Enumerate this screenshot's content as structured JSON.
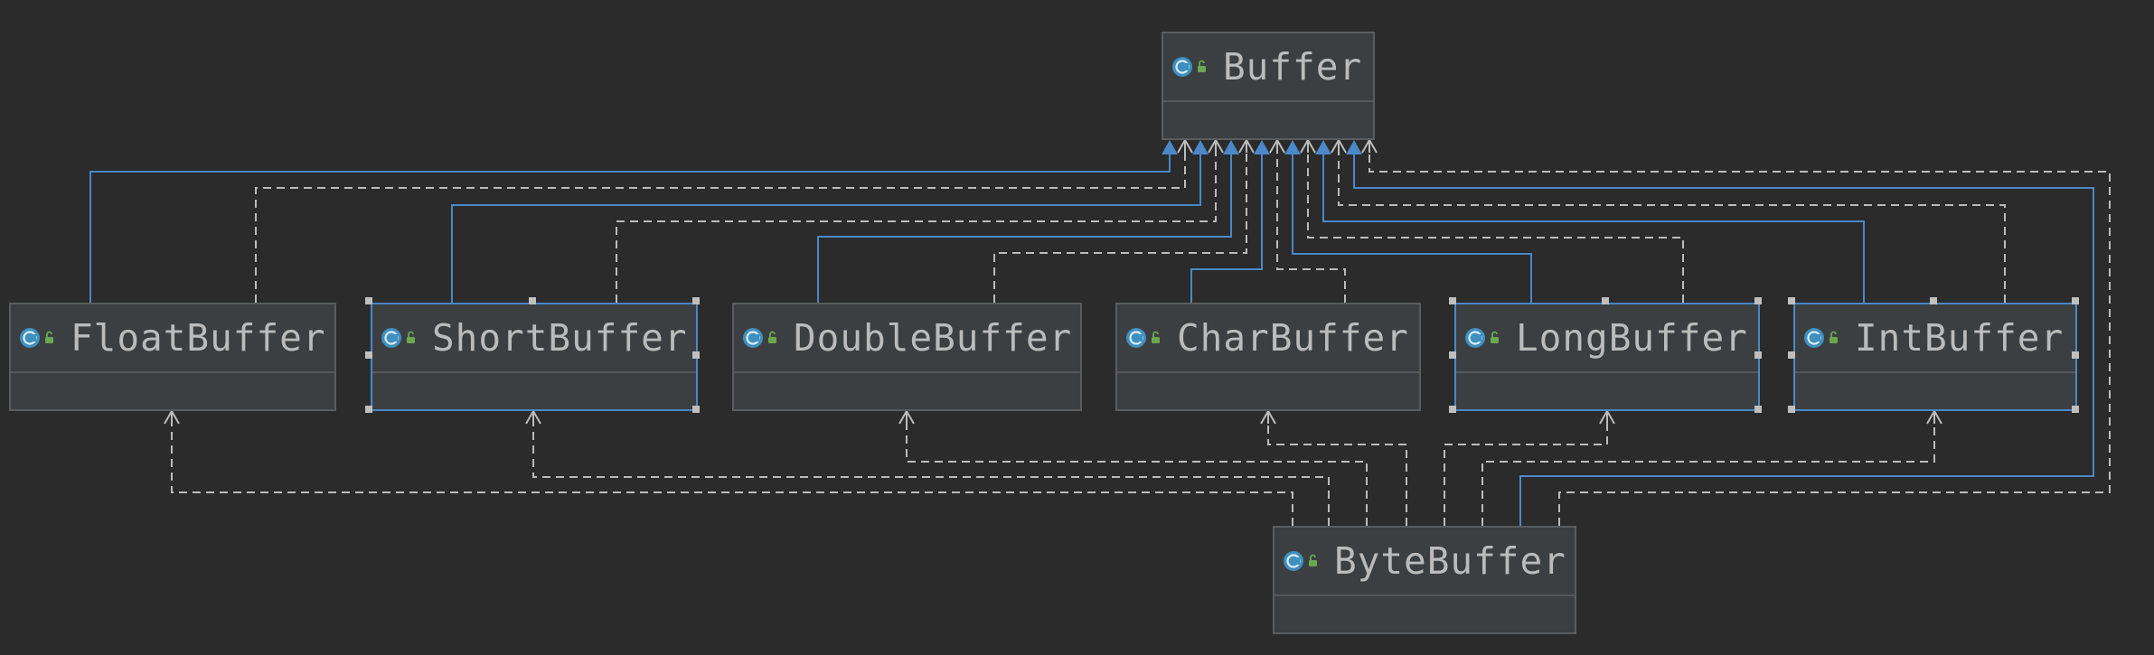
{
  "diagram": {
    "nodes": [
      {
        "id": "buffer",
        "label": "Buffer",
        "selected": false,
        "icon": "class-icon"
      },
      {
        "id": "float",
        "label": "FloatBuffer",
        "selected": false,
        "icon": "class-icon"
      },
      {
        "id": "short",
        "label": "ShortBuffer",
        "selected": true,
        "icon": "class-icon"
      },
      {
        "id": "double",
        "label": "DoubleBuffer",
        "selected": false,
        "icon": "class-icon"
      },
      {
        "id": "char",
        "label": "CharBuffer",
        "selected": false,
        "icon": "class-icon"
      },
      {
        "id": "long",
        "label": "LongBuffer",
        "selected": true,
        "icon": "class-icon"
      },
      {
        "id": "int",
        "label": "IntBuffer",
        "selected": true,
        "icon": "class-icon"
      },
      {
        "id": "byte",
        "label": "ByteBuffer",
        "selected": false,
        "icon": "class-icon"
      }
    ],
    "edges": [
      {
        "from": "float",
        "to": "buffer",
        "kind": "extends"
      },
      {
        "from": "float",
        "to": "buffer",
        "kind": "implements"
      },
      {
        "from": "short",
        "to": "buffer",
        "kind": "extends"
      },
      {
        "from": "short",
        "to": "buffer",
        "kind": "implements"
      },
      {
        "from": "double",
        "to": "buffer",
        "kind": "extends"
      },
      {
        "from": "double",
        "to": "buffer",
        "kind": "implements"
      },
      {
        "from": "char",
        "to": "buffer",
        "kind": "extends"
      },
      {
        "from": "char",
        "to": "buffer",
        "kind": "implements"
      },
      {
        "from": "long",
        "to": "buffer",
        "kind": "extends"
      },
      {
        "from": "long",
        "to": "buffer",
        "kind": "implements"
      },
      {
        "from": "int",
        "to": "buffer",
        "kind": "extends"
      },
      {
        "from": "int",
        "to": "buffer",
        "kind": "implements"
      },
      {
        "from": "byte",
        "to": "buffer",
        "kind": "extends"
      },
      {
        "from": "byte",
        "to": "buffer",
        "kind": "implements"
      },
      {
        "from": "byte",
        "to": "float",
        "kind": "implements"
      },
      {
        "from": "byte",
        "to": "short",
        "kind": "implements"
      },
      {
        "from": "byte",
        "to": "double",
        "kind": "implements"
      },
      {
        "from": "byte",
        "to": "char",
        "kind": "implements"
      },
      {
        "from": "byte",
        "to": "long",
        "kind": "implements"
      },
      {
        "from": "byte",
        "to": "int",
        "kind": "implements"
      }
    ],
    "colors": {
      "background": "#2b2b2b",
      "extends": "#4a88c7",
      "implements": "#bbbbbb",
      "node_fill": "#3c3f41",
      "text": "#bbbbbb"
    }
  }
}
